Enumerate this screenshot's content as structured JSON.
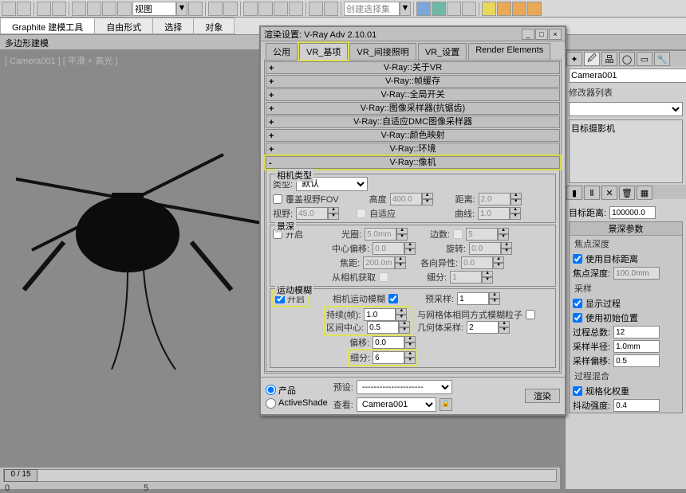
{
  "toolbar": {
    "view_label": "视图",
    "createset_label": "创建选择集"
  },
  "ribbon": {
    "tabs": [
      "Graphite 建模工具",
      "自由形式",
      "选择",
      "对象"
    ],
    "sub": "多边形建模"
  },
  "viewport": {
    "label": "[ Camera001 ] [ 平滑 + 高光 ]"
  },
  "dialog": {
    "title": "渲染设置: V-Ray Adv 2.10.01",
    "tabs": [
      "公用",
      "VR_基项",
      "VR_间接照明",
      "VR_设置",
      "Render Elements"
    ],
    "rollouts": [
      "V-Ray::关于VR",
      "V-Ray::帧缓存",
      "V-Ray::全局开关",
      "V-Ray::图像采样器(抗锯齿)",
      "V-Ray::自适应DMC图像采样器",
      "V-Ray::颜色映射",
      "V-Ray::环境",
      "V-Ray::像机"
    ],
    "camera": {
      "group_type": "相机类型",
      "type_label": "类型:",
      "type_value": "默认",
      "override_fov": "覆盖视野FOV",
      "fov_label": "视野:",
      "fov_value": "45.0",
      "height_label": "高度",
      "height_value": "400.0",
      "adaptive": "自适应",
      "dist_label": "距离:",
      "dist_value": "2.0",
      "curve_label": "曲线:",
      "curve_value": "1.0"
    },
    "dof": {
      "group": "景深",
      "enable": "开启",
      "aperture_label": "光圈:",
      "aperture_value": "5.0mm",
      "center_label": "中心偏移:",
      "center_value": "0.0",
      "focal_label": "焦距:",
      "focal_value": "200.0mm",
      "fromcam": "从相机获取",
      "sides_label": "边数:",
      "sides_value": "5",
      "rot_label": "旋转:",
      "rot_value": "0.0",
      "aniso_label": "各向异性:",
      "aniso_value": "0.0",
      "subdiv_label": "细分:",
      "subdiv_value": "1"
    },
    "moblur": {
      "group": "运动模糊",
      "enable": "开启",
      "cam_moblur": "相机运动模糊",
      "duration_label": "持续(帧):",
      "duration_value": "1.0",
      "intcenter_label": "区间中心:",
      "intcenter_value": "0.5",
      "bias_label": "偏移:",
      "bias_value": "0.0",
      "subdiv_label": "细分:",
      "subdiv_value": "6",
      "prepass_label": "预采样:",
      "prepass_value": "1",
      "mesh_particle": "与网格体相同方式模糊粒子",
      "geom_label": "几何体采样:",
      "geom_value": "2"
    },
    "footer": {
      "product": "产品",
      "activeshade": "ActiveShade",
      "preset_label": "预设:",
      "preset_value": "---------------------",
      "view_label": "查看:",
      "view_value": "Camera001",
      "render_btn": "渲染"
    }
  },
  "right": {
    "object_name": "Camera001",
    "modlist_label": "修改器列表",
    "mod_item": "目标摄影机",
    "target_dist_label": "目标距离:",
    "target_dist_value": "100000.0",
    "dof_group": "景深参数",
    "focal_depth": "焦点深度",
    "use_target": "使用目标距离",
    "focal_dist_label": "焦点深度:",
    "focal_dist_value": "100.0mm",
    "sample_group": "采样",
    "show_pass": "显示过程",
    "use_init": "使用初始位置",
    "passes_label": "过程总数:",
    "passes_value": "12",
    "radius_label": "采样半径:",
    "radius_value": "1.0mm",
    "bias_label": "采样偏移:",
    "bias_value": "0.5",
    "passblend_group": "过程混合",
    "normalize": "规格化权重",
    "dither_label": "抖动强度:",
    "dither_value": "0.4"
  },
  "timeline": {
    "thumb": "0 / 15",
    "ticks": [
      "0",
      "5"
    ]
  }
}
